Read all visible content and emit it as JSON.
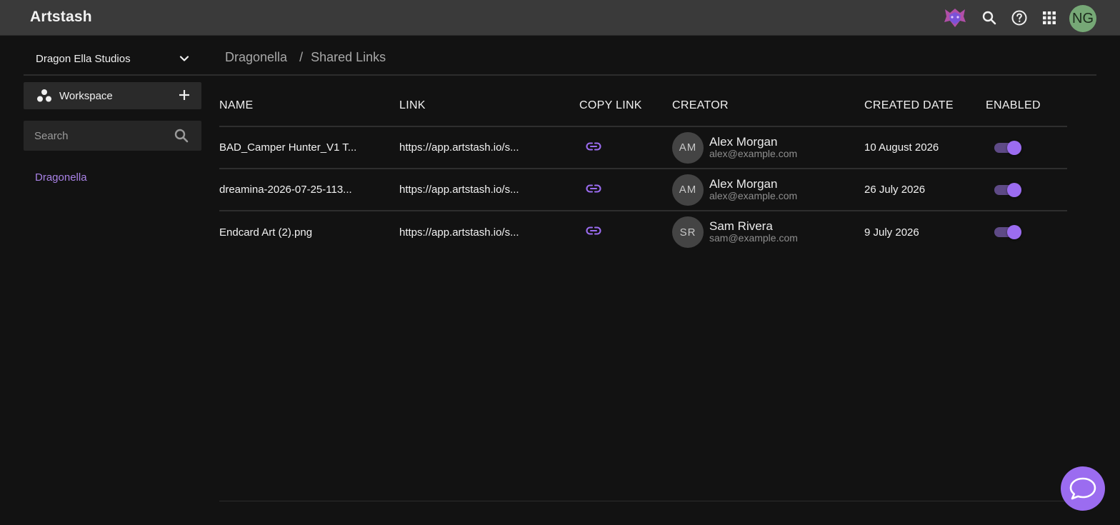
{
  "app": {
    "brand": "Artstash",
    "user_initials": "NG"
  },
  "sidebar": {
    "studio_name": "Dragon Ella Studios",
    "workspace_label": "Workspace",
    "search_placeholder": "Search",
    "items": [
      {
        "label": "Dragonella"
      }
    ]
  },
  "breadcrumb": {
    "root": "Dragonella",
    "separator": "/",
    "current": "Shared Links"
  },
  "table": {
    "headers": [
      "NAME",
      "LINK",
      "COPY LINK",
      "CREATOR",
      "CREATED DATE",
      "ENABLED"
    ],
    "rows": [
      {
        "name": "BAD_Camper Hunter_V1 T...",
        "link": "https://app.artstash.io/s...",
        "creator_initials": "AM",
        "creator_name": "Alex Morgan",
        "creator_email": "alex@example.com",
        "date": "10 August 2026",
        "enabled": true
      },
      {
        "name": "dreamina-2026-07-25-113...",
        "link": "https://app.artstash.io/s...",
        "creator_initials": "AM",
        "creator_name": "Alex Morgan",
        "creator_email": "alex@example.com",
        "date": "26 July 2026",
        "enabled": true
      },
      {
        "name": "Endcard Art (2).png",
        "link": "https://app.artstash.io/s...",
        "creator_initials": "SR",
        "creator_name": "Sam Rivera",
        "creator_email": "sam@example.com",
        "date": "9 July 2026",
        "enabled": true
      }
    ]
  },
  "colors": {
    "accent": "#9b6cf0",
    "topbar": "#3a3a3a",
    "background": "#121212"
  }
}
